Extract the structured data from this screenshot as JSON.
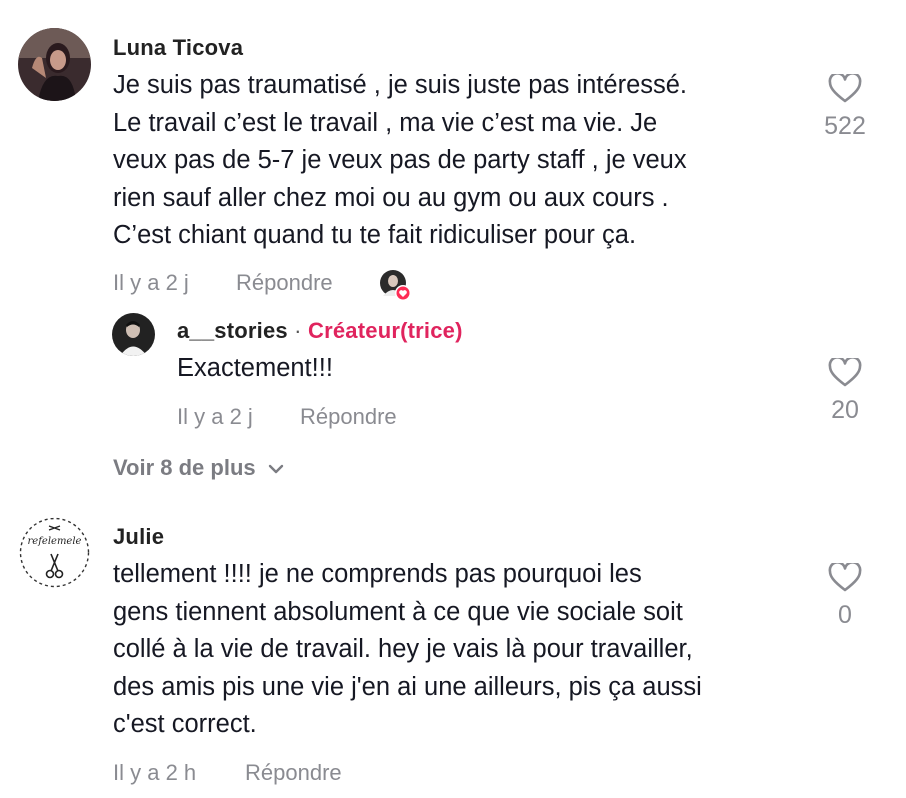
{
  "comments": [
    {
      "username": "Luna Ticova",
      "lines": [
        "Je suis pas traumatisé , je suis juste pas intéressé.",
        "Le travail c’est le travail , ma vie c’est ma vie. Je",
        "veux pas de 5-7 je veux pas de party staff , je veux",
        "rien sauf aller chez moi ou au gym ou aux cours .",
        "C’est chiant quand tu te fait ridiculiser pour ça."
      ],
      "time": "Il y a 2 j",
      "reply_label": "Répondre",
      "likes": "522",
      "liked_by_creator_icon": "heart-badge-icon"
    }
  ],
  "reply": {
    "username": "a__stories",
    "separator": "·",
    "badge": "Créateur(trice)",
    "text": "Exactement!!!",
    "time": "Il y a 2 j",
    "reply_label": "Répondre",
    "likes": "20"
  },
  "view_more": {
    "label": "Voir 8 de plus",
    "icon": "chevron-down-icon"
  },
  "comment2": {
    "username": "Julie",
    "avatar_text": "refelemele",
    "lines": [
      "tellement !!!! je ne comprends pas pourquoi les",
      "gens tiennent absolument à ce que vie sociale soit",
      "collé à la vie de travail. hey je vais là pour travailler,",
      "des amis pis une vie j'en ai une ailleurs, pis ça aussi",
      "c'est correct."
    ],
    "time": "Il y a 2 h",
    "reply_label": "Répondre",
    "likes": "0"
  },
  "colors": {
    "text": "#161823",
    "muted": "#8a8b91",
    "creator_badge": "#e0245e"
  }
}
